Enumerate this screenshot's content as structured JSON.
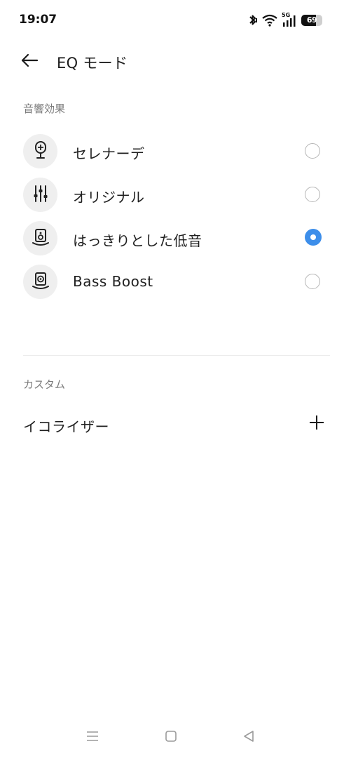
{
  "status_bar": {
    "time": "19:07",
    "network": "5G",
    "battery_level": "69",
    "battery_fraction": 0.69
  },
  "header": {
    "title": "EQ モード",
    "back_icon": "arrow-left-icon"
  },
  "sound_effects": {
    "section_title": "音響効果",
    "items": [
      {
        "label": "セレナーデ",
        "icon": "microphone-plus-icon",
        "selected": false
      },
      {
        "label": "オリジナル",
        "icon": "equalizer-sliders-icon",
        "selected": false
      },
      {
        "label": "はっきりとした低音",
        "icon": "speaker-icon",
        "selected": true
      },
      {
        "label": "Bass Boost",
        "icon": "subwoofer-icon",
        "selected": false
      }
    ]
  },
  "custom": {
    "section_title": "カスタム",
    "equalizer_label": "イコライザー",
    "add_icon": "plus-icon"
  },
  "colors": {
    "accent": "#3d8eea",
    "icon_background": "#efefef",
    "section_header": "#7a7a7a"
  },
  "navigation": {
    "icons": [
      "menu-icon",
      "home-square-icon",
      "back-triangle-icon"
    ]
  }
}
